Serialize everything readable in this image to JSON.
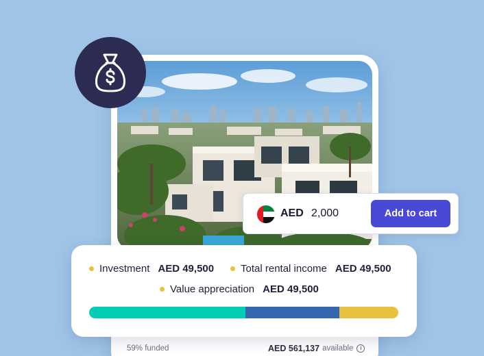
{
  "cart": {
    "currency": "AED",
    "amount": "2,000",
    "button_label": "Add to cart",
    "flag_icon": "uae-flag-icon"
  },
  "badge": {
    "icon": "money-bag-icon",
    "color": "#2c2b52"
  },
  "stats": {
    "investment_label": "Investment",
    "investment_value": "AED 49,500",
    "rental_label": "Total rental income",
    "rental_value": "AED 49,500",
    "appreciation_label": "Value appreciation",
    "appreciation_value": "AED 49,500"
  },
  "progress_bar": [
    {
      "color": "#00cdb3",
      "fraction": 0.505
    },
    {
      "color": "#3566b0",
      "fraction": 0.305
    },
    {
      "color": "#e8c23e",
      "fraction": 0.19
    }
  ],
  "footer": {
    "funded_text": "59% funded",
    "available_amount": "AED 561,137",
    "available_label": "available"
  },
  "colors": {
    "background": "#a0c4e8",
    "accent_button": "#4a48d6",
    "dot": "#e8c23e"
  }
}
